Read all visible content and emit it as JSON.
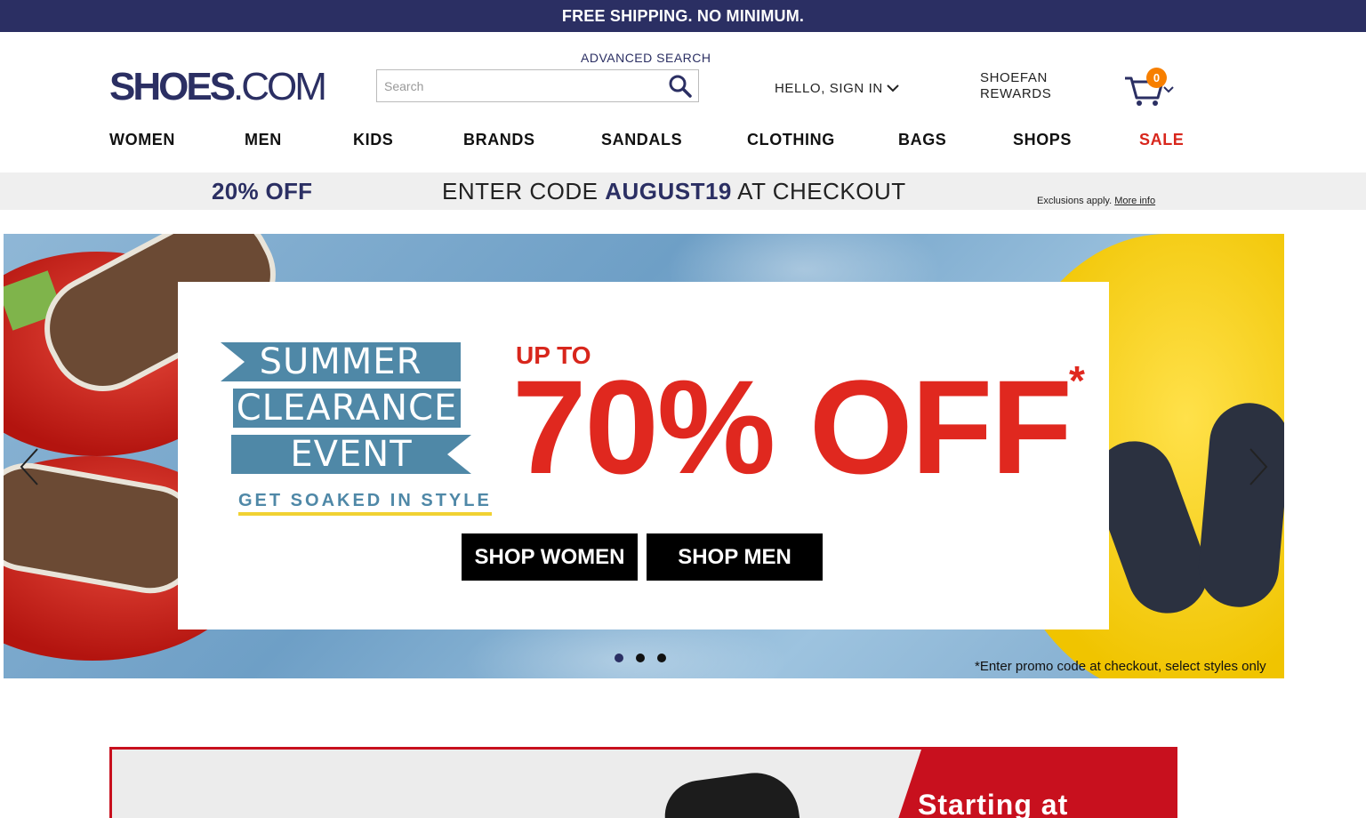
{
  "top_banner": {
    "text": "FREE SHIPPING. NO MINIMUM."
  },
  "header": {
    "logo_text_bold": "SHOES",
    "logo_text_light": ".COM",
    "advanced_search": "ADVANCED SEARCH",
    "search_placeholder": "Search",
    "search_value": "",
    "sign_in": "HELLO, SIGN IN",
    "rewards_line1": "SHOEFAN",
    "rewards_line2": "REWARDS",
    "cart_count": "0"
  },
  "nav": {
    "items": [
      "WOMEN",
      "MEN",
      "KIDS",
      "BRANDS",
      "SANDALS",
      "CLOTHING",
      "BAGS",
      "SHOPS",
      "SALE"
    ]
  },
  "promo_strip": {
    "discount": "20% OFF",
    "code_prefix": "ENTER CODE ",
    "code": "AUGUST19",
    "code_suffix": " AT CHECKOUT",
    "exclusions": "Exclusions apply.",
    "more_info": "More info"
  },
  "hero": {
    "ribbon_line1": "SUMMER",
    "ribbon_line2": "CLEARANCE",
    "ribbon_line3": "EVENT",
    "tagline": "GET SOAKED IN STYLE",
    "up_to": "UP TO",
    "discount": "70% OFF",
    "asterisk": "*",
    "shop_women": "SHOP WOMEN",
    "shop_men": "SHOP MEN",
    "footnote": "*Enter promo code at checkout, select styles only",
    "slide_count": 3,
    "active_slide": 1
  },
  "secondary_banner": {
    "text": "Starting at"
  },
  "colors": {
    "brand_navy": "#2b2f63",
    "sale_red": "#d8261c",
    "hero_red": "#e0281f",
    "ribbon_blue": "#4f88a7",
    "badge_orange": "#f77f00"
  },
  "icons": [
    "search-icon",
    "chevron-down-icon",
    "cart-icon",
    "chevron-left-icon",
    "chevron-right-icon"
  ]
}
